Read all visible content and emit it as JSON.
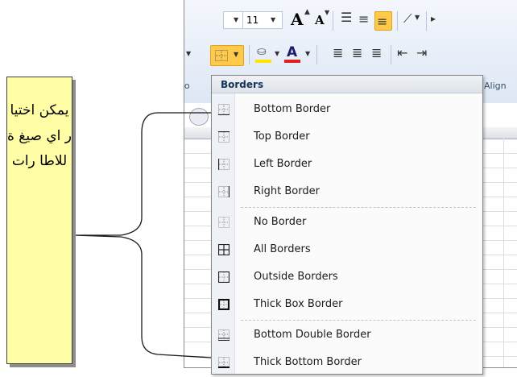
{
  "toolbar": {
    "font_size": "11",
    "grow_font": "A",
    "shrink_font": "A",
    "font_color_glyph": "A"
  },
  "ribbon_groups": {
    "font_label": "Fo",
    "alignment_label": "Align"
  },
  "menu": {
    "header": "Borders",
    "items": [
      {
        "label": "Bottom Border",
        "icon": "bottom-border-icon"
      },
      {
        "label": "Top Border",
        "icon": "top-border-icon"
      },
      {
        "label": "Left Border",
        "icon": "left-border-icon"
      },
      {
        "label": "Right Border",
        "icon": "right-border-icon"
      },
      {
        "label": "No Border",
        "icon": "no-border-icon"
      },
      {
        "label": "All Borders",
        "icon": "all-borders-icon"
      },
      {
        "label": "Outside Borders",
        "icon": "outside-borders-icon"
      },
      {
        "label": "Thick Box Border",
        "icon": "thick-box-border-icon"
      },
      {
        "label": "Bottom Double Border",
        "icon": "bottom-double-border-icon"
      },
      {
        "label": "Thick Bottom Border",
        "icon": "thick-bottom-border-icon"
      }
    ]
  },
  "callout": {
    "text": "يمكن اختيا ر اي صيغ ة للاطا رات"
  },
  "colors": {
    "callout_bg": "#fffea6",
    "highlight": "#ffc94a",
    "ribbon_top": "#f4f7fc",
    "ribbon_bottom": "#dde7f5",
    "font_color_bar": "#e02020",
    "fill_color_bar": "#ffe400"
  }
}
